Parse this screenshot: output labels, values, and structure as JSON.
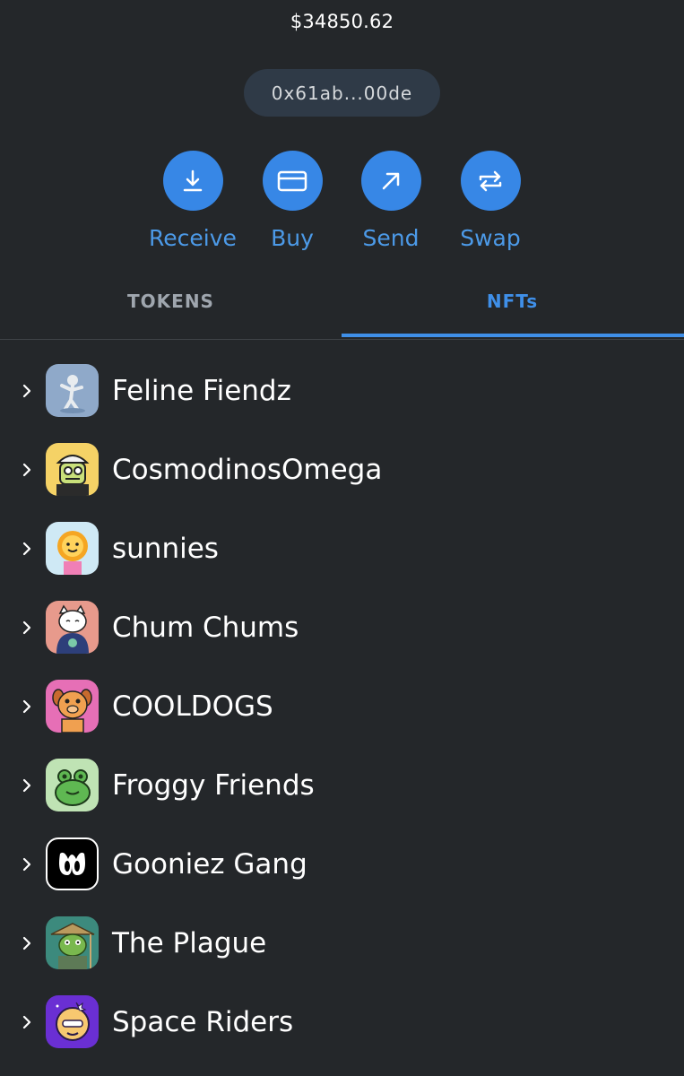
{
  "wallet": {
    "balance": "$34850.62",
    "address": "0x61ab...00de"
  },
  "actions": [
    {
      "label": "Receive",
      "icon": "download-arrow-icon"
    },
    {
      "label": "Buy",
      "icon": "credit-card-icon"
    },
    {
      "label": "Send",
      "icon": "arrow-up-right-icon"
    },
    {
      "label": "Swap",
      "icon": "swap-arrows-icon"
    }
  ],
  "tabs": {
    "tokens": "TOKENS",
    "nfts": "NFTs",
    "active": "NFTs"
  },
  "nft_collections": [
    {
      "name": "Feline Fiendz",
      "avatar_bg": "#8fa9c9"
    },
    {
      "name": "CosmodinosOmega",
      "avatar_bg": "#f5d266"
    },
    {
      "name": "sunnies",
      "avatar_bg": "#cfe9f5"
    },
    {
      "name": "Chum Chums",
      "avatar_bg": "#e79a8c"
    },
    {
      "name": "COOLDOGS",
      "avatar_bg": "#e66fb6"
    },
    {
      "name": "Froggy Friends",
      "avatar_bg": "#bfe3b4"
    },
    {
      "name": "Gooniez Gang",
      "avatar_bg": "#000000"
    },
    {
      "name": "The Plague",
      "avatar_bg": "#3c8a7d"
    },
    {
      "name": "Space Riders",
      "avatar_bg": "#6a2fd3"
    }
  ],
  "colors": {
    "background": "#24272a",
    "accent": "#3787e6",
    "pill": "#2f3a47"
  }
}
